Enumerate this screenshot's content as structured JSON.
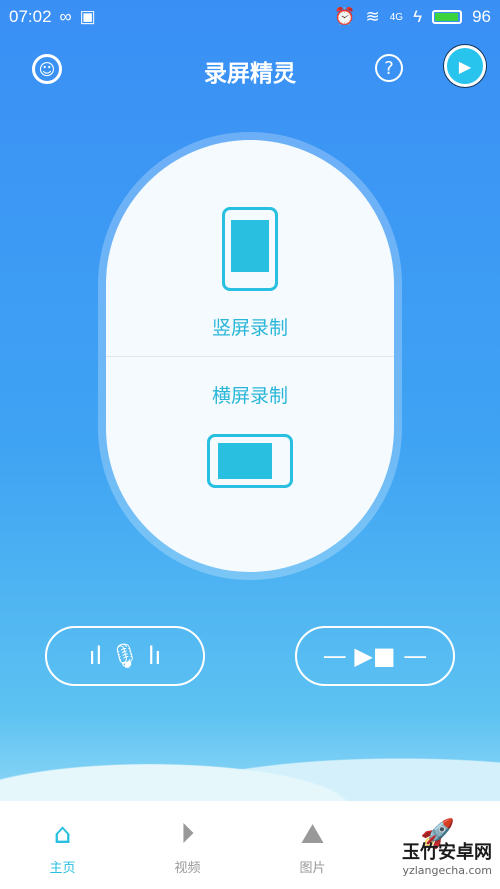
{
  "status": {
    "time": "07:02",
    "battery": "96",
    "network": "4G"
  },
  "header": {
    "title": "录屏精灵",
    "help": "?"
  },
  "main": {
    "portrait_label": "竖屏录制",
    "landscape_label": "横屏录制"
  },
  "tabs": [
    {
      "label": "主页",
      "icon": "home-icon",
      "active": true
    },
    {
      "label": "视频",
      "icon": "play-circle-icon"
    },
    {
      "label": "图片",
      "icon": "image-icon"
    },
    {
      "label": "",
      "icon": "rocket-icon"
    }
  ],
  "watermark": {
    "name": "玉竹安卓网",
    "url": "yzlangecha.com"
  },
  "colors": {
    "accent": "#29bfe0",
    "bg": "#3a8ff5"
  }
}
